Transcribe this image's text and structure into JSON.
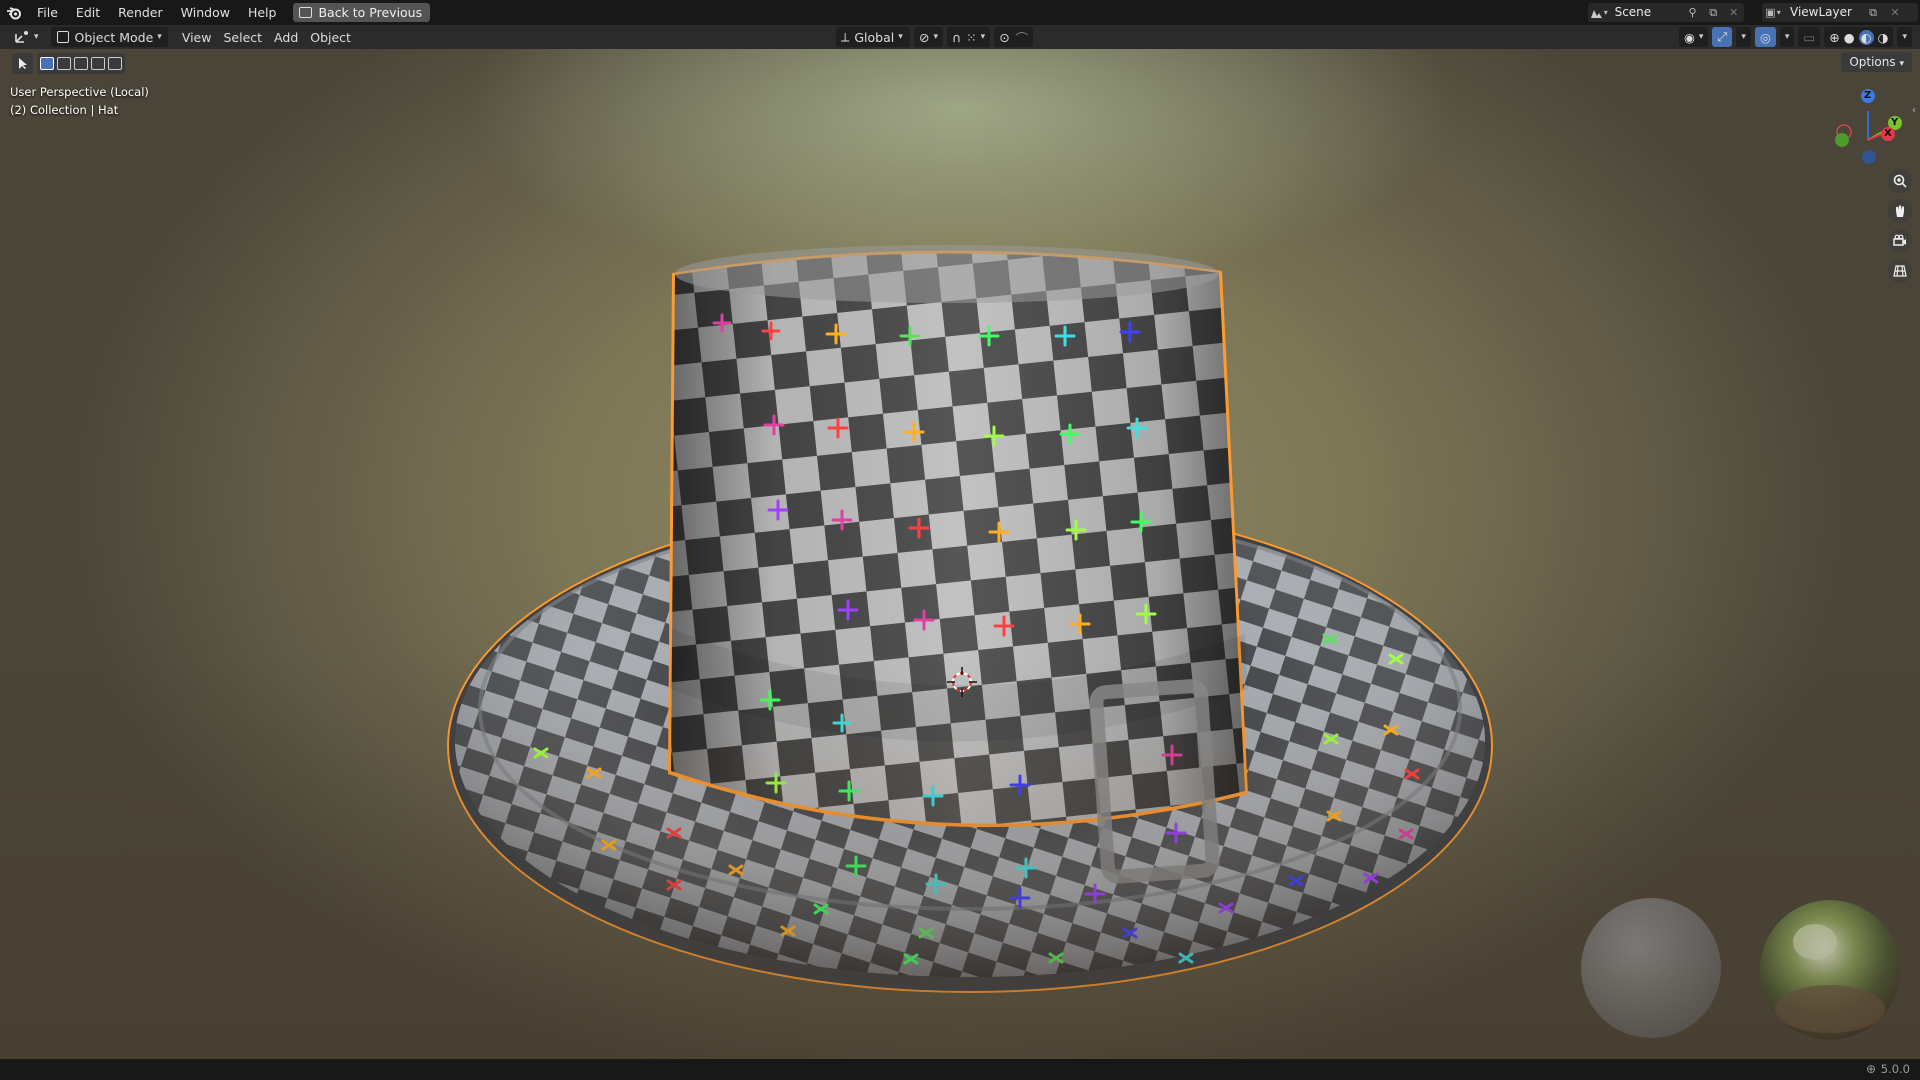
{
  "topbar": {
    "menus": [
      "File",
      "Edit",
      "Render",
      "Window",
      "Help"
    ],
    "back_button": "Back to Previous",
    "scene_name": "Scene",
    "view_layer": "ViewLayer"
  },
  "header": {
    "mode": "Object Mode",
    "menus": [
      "View",
      "Select",
      "Add",
      "Object"
    ],
    "transform_orientation": "Global"
  },
  "viewport": {
    "options_label": "Options",
    "perspective_label": "User Perspective (Local)",
    "collection_label": "(2) Collection | Hat",
    "gizmo_axes": {
      "z": "Z",
      "y": "Y",
      "x": "X"
    }
  },
  "status": {
    "version": "5.0.0"
  },
  "colors": {
    "selection_outline": "#ff9a2e",
    "checker_dark": "#474747",
    "checker_light": "#bdbdbd"
  }
}
